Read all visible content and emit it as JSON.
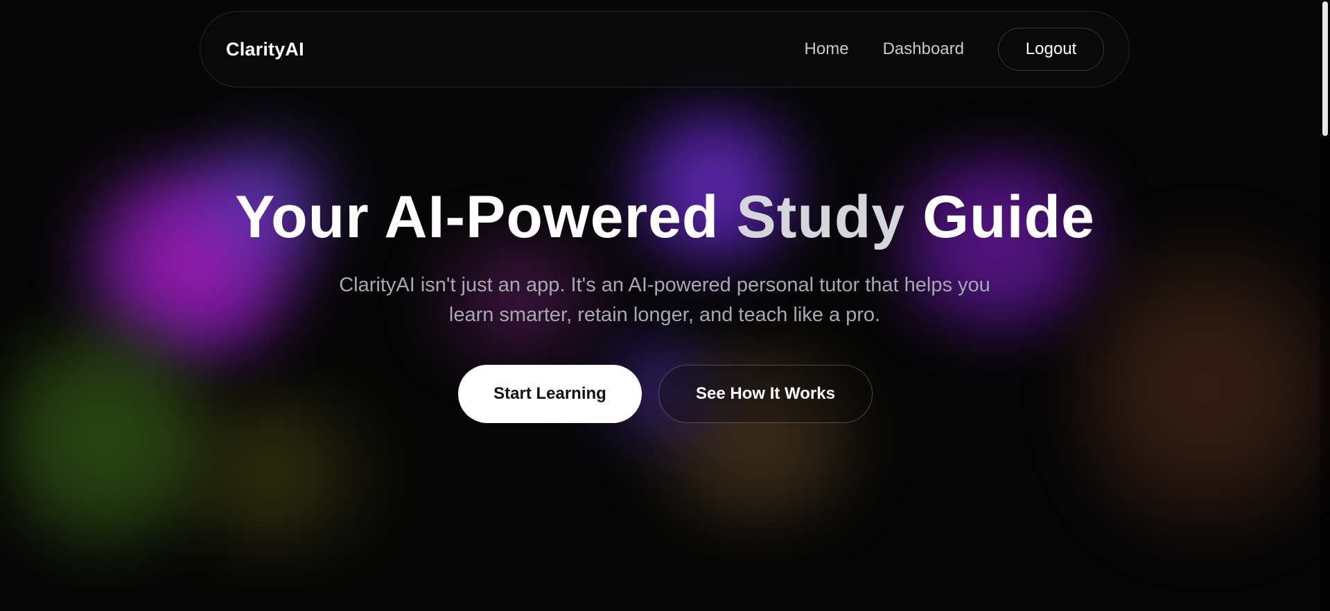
{
  "nav": {
    "brand": "ClarityAI",
    "links": [
      {
        "label": "Home"
      },
      {
        "label": "Dashboard"
      }
    ],
    "logout_label": "Logout"
  },
  "hero": {
    "title_start": "Your AI-Powered ",
    "title_accent": "Study",
    "title_end": " Guide",
    "subtitle": "ClarityAI isn't just an app. It's an AI-powered personal tutor that helps you learn smarter, retain longer, and teach like a pro.",
    "primary_cta": "Start Learning",
    "secondary_cta": "See How It Works"
  },
  "colors": {
    "background": "#060606",
    "text": "#ffffff",
    "muted_text": "#a8a8b2",
    "accent_purple": "#c21bd2",
    "accent_violet": "#6a3fd0"
  }
}
